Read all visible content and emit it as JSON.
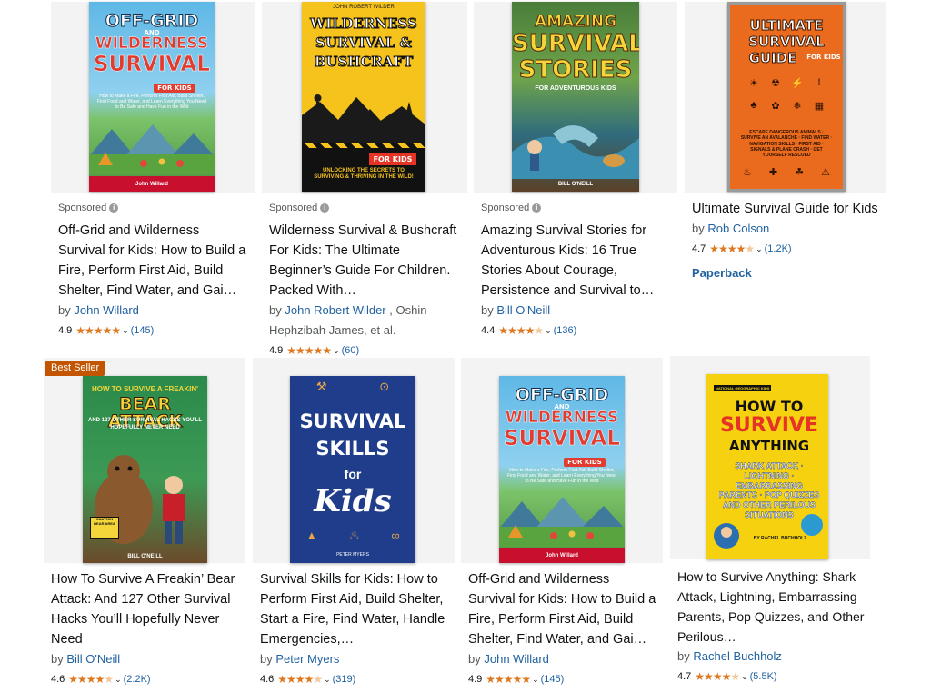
{
  "row1": [
    {
      "sponsored": "Sponsored",
      "title": "Off-Grid and Wilderness Survival for Kids: How to Build a Fire, Perform First Aid, Build Shelter, Find Water, and Gai…",
      "by": "by",
      "author": "John Willard",
      "author_rest": "",
      "rating": "4.9",
      "count": "(145)",
      "cover": {
        "line1": "OFF-GRID",
        "line1b": "AND",
        "line2": "WILDERNESS",
        "line3": "SURVIVAL",
        "tag": "FOR KIDS",
        "sub": "How to Make a Fire, Perform First Aid, Build Shelter, Find Food and Water, and Learn Everything You Need to Be Safe and Have Fun in the Wild",
        "author": "John Willard"
      }
    },
    {
      "sponsored": "Sponsored",
      "title": "Wilderness Survival & Bushcraft For Kids: The Ultimate Beginner’s Guide For Children. Packed With…",
      "by": "by",
      "author": "John Robert Wilder",
      "author_rest": ", Oshin Hephzibah James, et al.",
      "rating": "4.9",
      "count": "(60)",
      "cover": {
        "top": "JOHN ROBERT WILDER",
        "line1": "WILDERNESS",
        "line2": "SURVIVAL &",
        "line3": "BUSHCRAFT",
        "tag": "FOR KIDS",
        "sub": "UNLOCKING THE SECRETS TO SURVIVING & THRIVING IN THE WILD!"
      }
    },
    {
      "sponsored": "Sponsored",
      "title": "Amazing Survival Stories for Adventurous Kids: 16 True Stories About Courage, Persistence and Survival to…",
      "by": "by",
      "author": "Bill O'Neill",
      "author_rest": "",
      "rating": "4.4",
      "count": "(136)",
      "cover": {
        "line1": "AMAZING",
        "line2": "SURVIVAL",
        "line3": "STORIES",
        "tag": "FOR ADVENTUROUS KIDS",
        "author": "BILL O'NEILL"
      }
    },
    {
      "title": "Ultimate Survival Guide for Kids",
      "by": "by",
      "author": "Rob Colson",
      "rating": "4.7",
      "count": "(1.2K)",
      "format": "Paperback",
      "cover": {
        "line1": "ULTIMATE",
        "line2": "SURVIVAL",
        "line3": "GUIDE",
        "tag": "FOR KIDS",
        "sub": "ESCAPE DANGEROUS ANIMALS · SURVIVE AN AVALANCHE · FIND WATER · NAVIGATION SKILLS · FIRST AID · SIGNALS & PLANE CRASH · GET YOURSELF RESCUED"
      }
    }
  ],
  "row2": [
    {
      "badge": "Best Seller",
      "title": "How To Survive A Freakin’ Bear Attack: And 127 Other Survival Hacks You’ll Hopefully Never Need",
      "by": "by",
      "author": "Bill O'Neill",
      "rating": "4.6",
      "count": "(2.2K)",
      "cover": {
        "line1": "HOW TO SURVIVE A FREAKIN'",
        "line2": "BEAR ATTACK",
        "line3": "AND 127 OTHER SURVIVAL HACKS YOU'LL HOPEFULLY NEVER NEED",
        "sign": "CAUTION BEAR AREA",
        "author": "BILL O'NEILL"
      }
    },
    {
      "title": "Survival Skills for Kids: How to Perform First Aid, Build Shelter, Start a Fire, Find Water, Handle Emergencies,…",
      "by": "by",
      "author": "Peter Myers",
      "rating": "4.6",
      "count": "(319)",
      "cover": {
        "line1": "SURVIVAL",
        "line2": "SKILLS",
        "line3": "for",
        "line4": "Kids",
        "author": "PETER MYERS"
      }
    },
    {
      "title": "Off-Grid and Wilderness Survival for Kids: How to Build a Fire, Perform First Aid, Build Shelter, Find Water, and Gai…",
      "by": "by",
      "author": "John Willard",
      "rating": "4.9",
      "count": "(145)",
      "cover": {
        "line1": "OFF-GRID",
        "line1b": "AND",
        "line2": "WILDERNESS",
        "line3": "SURVIVAL",
        "tag": "FOR KIDS",
        "sub": "How to Make a Fire, Perform First Aid, Build Shelter, Find Food and Water, and Learn Everything You Need to Be Safe and Have Fun in the Wild",
        "author": "John Willard"
      }
    },
    {
      "title": "How to Survive Anything: Shark Attack, Lightning, Embarrassing Parents, Pop Quizzes, and Other Perilous…",
      "by": "by",
      "author": "Rachel Buchholz",
      "rating": "4.7",
      "count": "(5.5K)",
      "cover": {
        "brand": "NATIONAL GEOGRAPHIC KIDS",
        "line1": "HOW TO",
        "line2": "SURVIVE",
        "line3": "ANYTHING",
        "sub": "SHARK ATTACK · LIGHTNING · EMBARRASSING PARENTS · POP QUIZZES AND OTHER PERILOUS SITUATIONS",
        "author": "BY RACHEL BUCHHOLZ"
      }
    }
  ],
  "stars": {
    "4.9": "★★★★★",
    "4.7": "★★★★☆",
    "4.6": "★★★★☆",
    "4.4": "★★★★☆"
  },
  "colors": {
    "link": "#2162a1",
    "star": "#de7921",
    "badge": "#c45500"
  }
}
